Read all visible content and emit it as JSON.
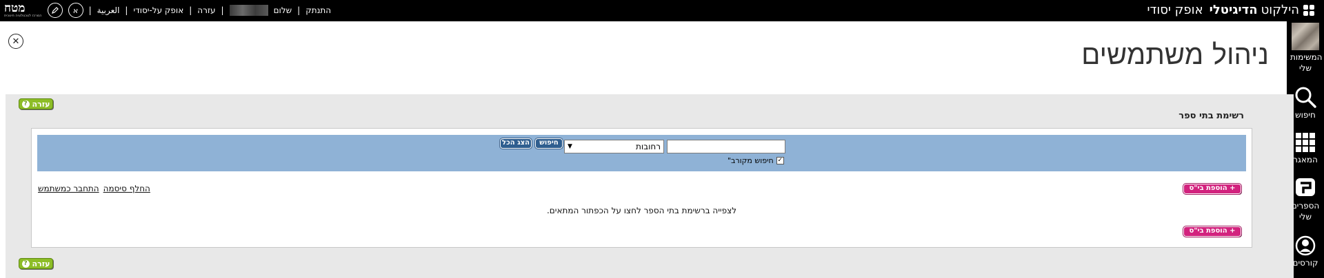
{
  "topbar": {
    "brand_part1": "הילקוט",
    "brand_part2": "הדיגיטלי",
    "brand_part3": "אופק יסודי",
    "logo_text": "מטח",
    "logo_subtext": "המרכז לטכנולוגיה חינוכית",
    "accessibility_label": "א",
    "arabic_link": "العربية",
    "ofek_link": "אופק על-יסודי",
    "help_link": "עזרה",
    "greeting": "שלום",
    "logout_link": "התנתק"
  },
  "sidebar": {
    "my_lists": "המשימות שלי",
    "search": "חיפוש",
    "repository": "המאגר",
    "my_books": "הספרים שלי",
    "courses": "קורסים"
  },
  "page": {
    "title": "ניהול משתמשים"
  },
  "panel": {
    "help_label": "עזרה",
    "section_heading": "רשימת בתי ספר",
    "search_input_value": "",
    "city_select_value": "רחובות",
    "search_button": "חיפוש",
    "show_all_button": "הצג הכל",
    "approx_search_label": "חיפוש מקורב\"",
    "approx_search_checked": true,
    "add_school_button": "+ הוספת בי\"ס",
    "link_change_password": "החלף סיסמה",
    "link_login_as_user": "התחבר כמשתמש",
    "info_text": "לצפייה ברשימת בתי הספר לחצו על הכפתור המתאים."
  },
  "colors": {
    "topbar_bg": "#000000",
    "searchbar_bg": "#8fb2d6",
    "add_button_bg": "#d2227e",
    "help_button_bg": "#8dbd27",
    "blue_button_bg": "#2f5e8f"
  }
}
